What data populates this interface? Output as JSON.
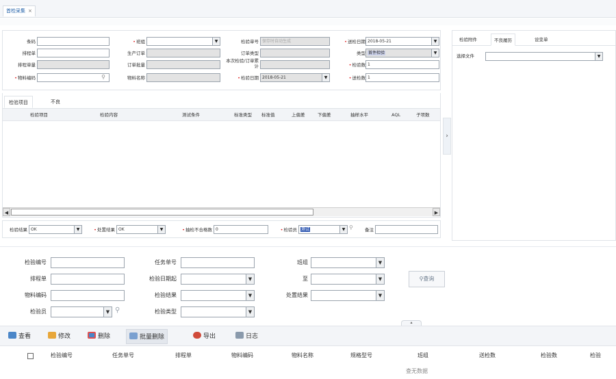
{
  "tabbar": {
    "tab_label": "首检采集",
    "close": "×"
  },
  "form": {
    "barcode": "条码",
    "shift": "班组",
    "inspect_no": "检验单号",
    "inspect_no_value": "保存时自动生成",
    "send_date": "送检日期",
    "send_date_value": "2018-05-21",
    "schedule": "排程单",
    "prod_order": "生产订单",
    "order_type": "订单类型",
    "type": "类型",
    "type_value": "首件检验",
    "schedule_qty": "排程单量",
    "order_qty": "订单批量",
    "this_total": "本次检验/订单累计",
    "inspect_qty": "检验数",
    "inspect_qty_value": "1",
    "material_code": "物料编码",
    "material_name": "物料名称",
    "inspect_date": "检验日期",
    "inspect_date_value": "2018-05-21",
    "send_qty": "送检数",
    "send_qty_value": "1"
  },
  "ltabs": {
    "items": "检验项目",
    "bad": "不良"
  },
  "grid": {
    "headers": [
      "检验项目",
      "检验内容",
      "测试条件",
      "标准类型",
      "标准值",
      "上偏差",
      "下偏差",
      "抽样水平",
      "AQL",
      "子项数"
    ]
  },
  "lfoot": {
    "result": "检验结果",
    "result_value": "OK",
    "handle": "处置结果",
    "handle_value": "OK",
    "sample_bad": "抽检不合格数",
    "sample_bad_value": "0",
    "inspector": "检验员",
    "inspector_value": "测试",
    "remark": "备注"
  },
  "rpanel": {
    "tab1": "检验附件",
    "tab2": "不良履历",
    "tab3": "设变单",
    "choose_file": "选择文件"
  },
  "query": {
    "inspect_no": "检验编号",
    "task_no": "任务单号",
    "shift": "班组",
    "schedule": "排程单",
    "date_from": "检验日期起",
    "to": "至",
    "material_code": "物料编码",
    "result": "检验结果",
    "handle": "处置结果",
    "inspector": "检验员",
    "type": "检验类型",
    "search_btn": "查询"
  },
  "toolbar": {
    "view": "查看",
    "edit": "修改",
    "delete": "删除",
    "batch_delete": "批量删除",
    "export": "导出",
    "log": "日志"
  },
  "bottom": {
    "headers": [
      "检验编号",
      "任务单号",
      "排程单",
      "物料编码",
      "物料名称",
      "规格型号",
      "班组",
      "送检数",
      "检验数",
      "检验"
    ],
    "nodata": "查无数据"
  },
  "colors": {
    "accent": "#1f5fa8",
    "required": "#e02020"
  }
}
